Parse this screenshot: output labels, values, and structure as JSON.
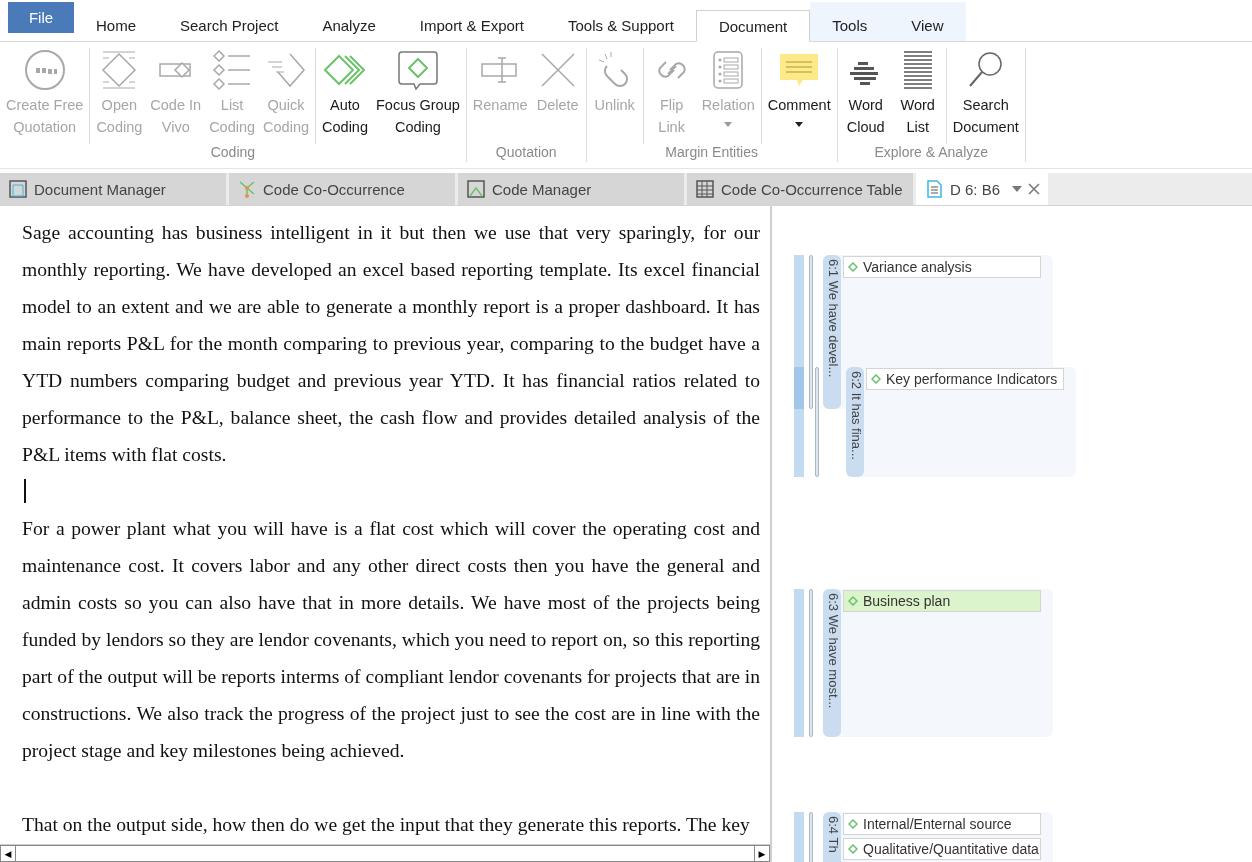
{
  "ribbon_tabs": [
    {
      "label": "File",
      "kind": "file",
      "selected": false
    },
    {
      "label": "Home",
      "kind": "plain",
      "selected": false
    },
    {
      "label": "Search Project",
      "kind": "plain",
      "selected": false
    },
    {
      "label": "Analyze",
      "kind": "plain",
      "selected": false
    },
    {
      "label": "Import & Export",
      "kind": "plain",
      "selected": false
    },
    {
      "label": "Tools & Support",
      "kind": "plain",
      "selected": false
    },
    {
      "label": "Document",
      "kind": "contextual",
      "selected": true
    },
    {
      "label": "Tools",
      "kind": "contextual",
      "selected": false
    },
    {
      "label": "View",
      "kind": "contextual",
      "selected": false
    }
  ],
  "ribbon_groups": [
    {
      "label": "Coding",
      "sections": [
        [
          {
            "lines": [
              "Create Free",
              "Quotation"
            ],
            "kind": "quote",
            "disabled": true,
            "dropdown": false
          }
        ],
        [
          {
            "lines": [
              "Open",
              "Coding"
            ],
            "kind": "open",
            "disabled": true,
            "dropdown": false
          },
          {
            "lines": [
              "Code In",
              "Vivo"
            ],
            "kind": "vivo",
            "disabled": true,
            "dropdown": false
          },
          {
            "lines": [
              "List",
              "Coding"
            ],
            "kind": "list",
            "disabled": true,
            "dropdown": false
          },
          {
            "lines": [
              "Quick",
              "Coding"
            ],
            "kind": "quick",
            "disabled": true,
            "dropdown": false
          }
        ],
        [
          {
            "lines": [
              "Auto",
              "Coding"
            ],
            "kind": "auto",
            "disabled": false,
            "dropdown": false
          },
          {
            "lines": [
              "Focus Group",
              "Coding"
            ],
            "kind": "focus",
            "disabled": false,
            "dropdown": false
          }
        ]
      ]
    },
    {
      "label": "Quotation",
      "sections": [
        [
          {
            "lines": [
              "Rename"
            ],
            "kind": "rename",
            "disabled": true,
            "dropdown": false
          },
          {
            "lines": [
              "Delete"
            ],
            "kind": "delete",
            "disabled": true,
            "dropdown": false
          }
        ]
      ]
    },
    {
      "label": "Margin Entities",
      "sections": [
        [
          {
            "lines": [
              "Unlink"
            ],
            "kind": "unlink",
            "disabled": true,
            "dropdown": false
          }
        ],
        [
          {
            "lines": [
              "Flip",
              "Link"
            ],
            "kind": "flip",
            "disabled": true,
            "dropdown": false
          },
          {
            "lines": [
              "Relation"
            ],
            "kind": "relation",
            "disabled": true,
            "dropdown": true
          }
        ],
        [
          {
            "lines": [
              "Comment"
            ],
            "kind": "comment",
            "disabled": false,
            "dropdown": true
          }
        ]
      ]
    },
    {
      "label": "Explore & Analyze",
      "sections": [
        [
          {
            "lines": [
              "Word",
              "Cloud"
            ],
            "kind": "cloud",
            "disabled": false,
            "dropdown": false
          },
          {
            "lines": [
              "Word",
              "List"
            ],
            "kind": "wordlist",
            "disabled": false,
            "dropdown": false
          }
        ],
        [
          {
            "lines": [
              "Search",
              "Document"
            ],
            "kind": "search",
            "disabled": false,
            "dropdown": false
          }
        ]
      ]
    }
  ],
  "doc_tabs": [
    {
      "label": "Document Manager",
      "kind": "manager",
      "selected": false,
      "closable": false
    },
    {
      "label": "Code Co-Occurrence",
      "kind": "network",
      "selected": false,
      "closable": false
    },
    {
      "label": "Code Manager",
      "kind": "codes",
      "selected": false,
      "closable": false
    },
    {
      "label": "Code Co-Occurrence Table",
      "kind": "table",
      "selected": false,
      "closable": false
    },
    {
      "label": "D 6: B6",
      "kind": "document",
      "selected": true,
      "closable": true
    }
  ],
  "document": {
    "paragraphs": [
      "Sage accounting has business intelligent in it but then we use that very sparingly, for our monthly reporting. We have developed an excel based reporting template. Its excel financial model to an extent and we are able to generate a monthly report is a proper dashboard. It has main reports P&L for the month comparing to previous year, comparing to the budget have a YTD numbers comparing budget and previous year YTD. It has financial ratios related to performance to the P&L, balance sheet, the cash flow and provides detailed analysis of the P&L items with flat costs.",
      "For a power plant what you will have is a flat cost which will cover the operating cost and maintenance cost. It  covers labor and any other direct costs then you have the general and admin costs so you can also have that in more details. We have most of the projects being funded by lendors so they are lendor covenants, which you need to report on, so this reporting part of the output will be reports interms of compliant lendor covenants for projects that are in constructions. We also track the progress of the project just to see the cost are in line with the project stage and key milestones being achieved.",
      "That on the output side, how then do we get the input that they generate this reports. The key"
    ],
    "scroll_left": "◀",
    "scroll_right": "▶"
  },
  "margin": {
    "quotations": [
      {
        "label": "6:1 We have devel...",
        "codes": [
          {
            "label": "Variance analysis",
            "highlighted": false
          }
        ]
      },
      {
        "label": "6:2 It has fina...",
        "codes": [
          {
            "label": "Key performance Indicators",
            "highlighted": false
          }
        ]
      },
      {
        "label": "6:3 We have most...",
        "codes": [
          {
            "label": "Business plan",
            "highlighted": true
          }
        ]
      },
      {
        "label": "6:4 Th",
        "codes": [
          {
            "label": "Internal/Enternal source",
            "highlighted": false
          },
          {
            "label": "Qualitative/Quantitative data",
            "highlighted": false
          }
        ]
      }
    ]
  }
}
